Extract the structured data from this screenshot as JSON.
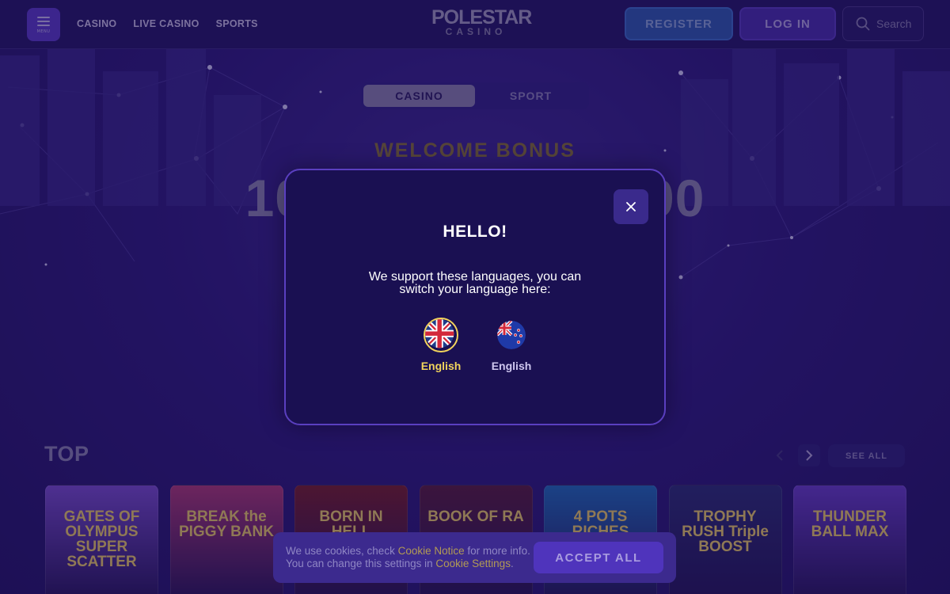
{
  "header": {
    "menu_label": "MENU",
    "nav": [
      "CASINO",
      "LIVE CASINO",
      "SPORTS"
    ],
    "logo_main": "POLESTAR",
    "logo_sub": "CASINO",
    "register_label": "REGISTER",
    "login_label": "LOG IN",
    "search_placeholder": "Search"
  },
  "hero": {
    "tabs": [
      "CASINO",
      "SPORT"
    ],
    "active_tab": "CASINO",
    "welcome_title": "WELCOME BONUS",
    "amount_left": "10",
    "amount_right": "00"
  },
  "top_section": {
    "title": "TOP",
    "see_all_label": "SEE ALL",
    "games": [
      {
        "title": "GATES OF OLYMPUS SUPER SCATTER",
        "color": "#7c4fd6"
      },
      {
        "title": "BREAK the PIGGY BANK",
        "color": "#b33b7a"
      },
      {
        "title": "BORN IN HELL",
        "color": "#7a1f2a"
      },
      {
        "title": "BOOK OF RA",
        "color": "#5a1e3e"
      },
      {
        "title": "4 POTS RICHES",
        "color": "#1f6fc2"
      },
      {
        "title": "TROPHY RUSH Triple BOOST",
        "color": "#2b2f7a"
      },
      {
        "title": "THUNDER BALL MAX",
        "color": "#6a3fd0"
      }
    ]
  },
  "modal": {
    "title": "HELLO!",
    "message": "We support these languages, you can switch your language here:",
    "languages": [
      {
        "name": "English",
        "flag": "uk-flag-icon",
        "selected": true
      },
      {
        "name": "English",
        "flag": "nz-flag-icon",
        "selected": false
      }
    ]
  },
  "cookie": {
    "text_1": "We use cookies, check ",
    "link_1": "Cookie Notice",
    "text_2": " for more info.",
    "text_3": "You can change this settings in ",
    "link_2": "Cookie Settings",
    "text_4": ".",
    "accept_label": "ACCEPT ALL"
  },
  "colors": {
    "background": "#2d1a7a",
    "modal": "#1a1052",
    "accent_gold": "#f2d45c",
    "register": "#2f5bb6"
  }
}
